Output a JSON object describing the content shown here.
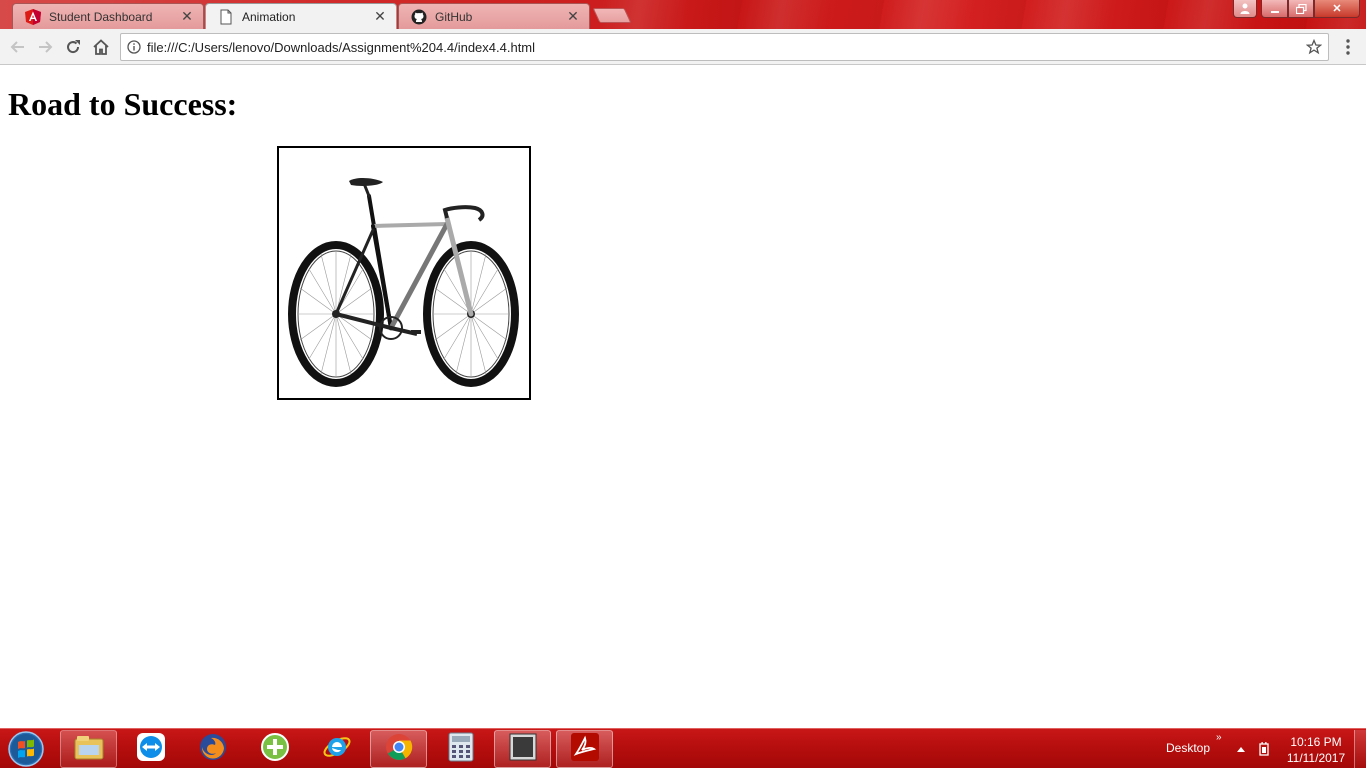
{
  "browser": {
    "tabs": [
      {
        "label": "Student Dashboard",
        "icon": "angular-icon",
        "active": false
      },
      {
        "label": "Animation",
        "icon": "document-icon",
        "active": true
      },
      {
        "label": "GitHub",
        "icon": "github-icon",
        "active": false
      }
    ],
    "address_bar": {
      "url": "file:///C:/Users/lenovo/Downloads/Assignment%204.4/index4.4.html"
    },
    "colors": {
      "titlebar": "#c81616",
      "toolbar": "#f2f2f2"
    }
  },
  "page": {
    "heading": "Road to Success:",
    "image_icon": "bicycle-image"
  },
  "taskbar": {
    "apps": [
      {
        "name": "file-explorer-icon"
      },
      {
        "name": "teamviewer-icon"
      },
      {
        "name": "firefox-icon"
      },
      {
        "name": "calculator-plus-icon"
      },
      {
        "name": "internet-explorer-icon"
      },
      {
        "name": "chrome-icon"
      },
      {
        "name": "calculator-icon"
      },
      {
        "name": "window-icon"
      },
      {
        "name": "adobe-reader-icon"
      }
    ],
    "tray_label": "Desktop",
    "tray_chevron": "»",
    "time": "10:16 PM",
    "date": "11/11/2017"
  }
}
